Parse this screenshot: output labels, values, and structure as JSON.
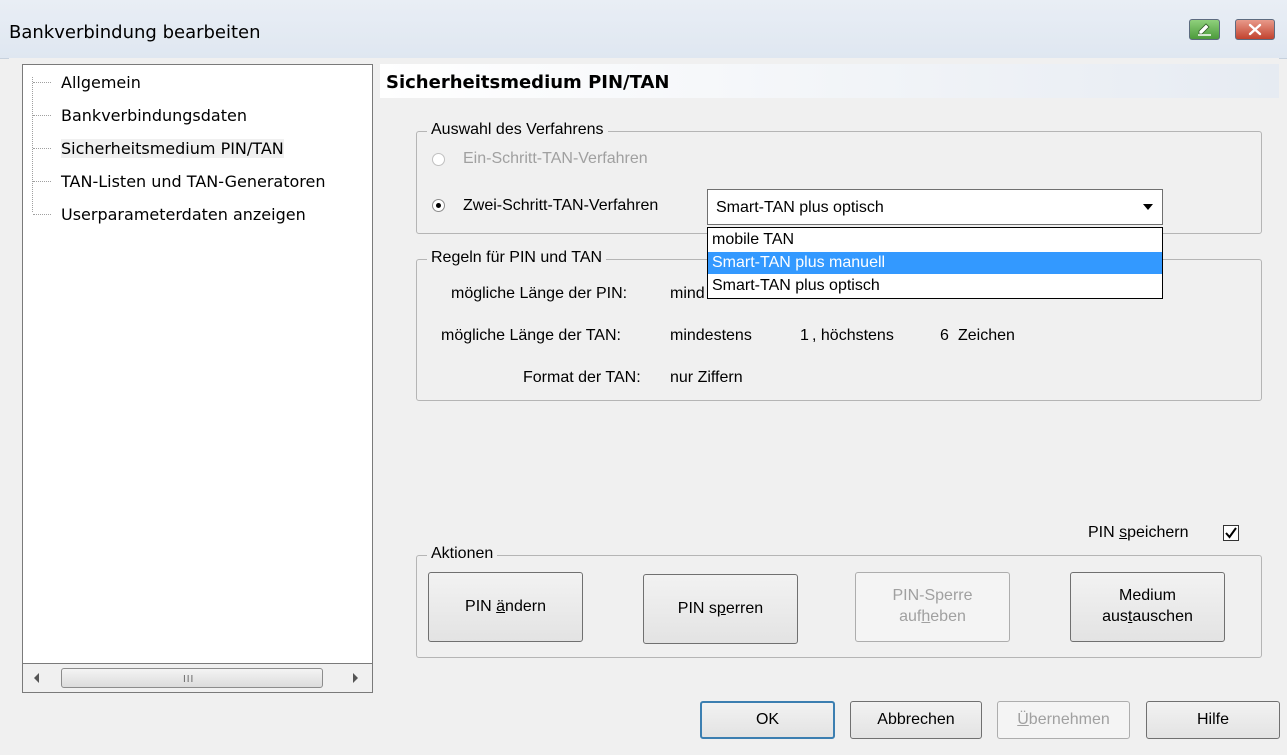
{
  "window": {
    "title": "Bankverbindung bearbeiten"
  },
  "tree": {
    "items": [
      {
        "label": "Allgemein"
      },
      {
        "label": "Bankverbindungsdaten"
      },
      {
        "label": "Sicherheitsmedium PIN/TAN"
      },
      {
        "label": "TAN-Listen und TAN-Generatoren"
      },
      {
        "label": "Userparameterdaten anzeigen"
      }
    ],
    "scroll_grip": "III"
  },
  "section": {
    "title": "Sicherheitsmedium PIN/TAN"
  },
  "verfahren": {
    "group_title": "Auswahl des Verfahrens",
    "option1": "Ein-Schritt-TAN-Verfahren",
    "option2": "Zwei-Schritt-TAN-Verfahren",
    "combo_value": "Smart-TAN plus optisch",
    "combo_options": [
      "mobile TAN",
      "Smart-TAN plus manuell",
      "Smart-TAN plus optisch"
    ],
    "highlighted_option": "Smart-TAN plus manuell"
  },
  "regeln": {
    "group_title": "Regeln für PIN und TAN",
    "pin_label": "mögliche Länge der PIN:",
    "pin_value_prefix": "mind",
    "tan_label": "mögliche Länge der TAN:",
    "tan_min_label": "mindestens",
    "tan_min": "1",
    "tan_max_label": ", höchstens",
    "tan_max": "6",
    "tan_unit": "Zeichen",
    "format_label": "Format der TAN:",
    "format_value": "nur Ziffern"
  },
  "pin_speichern": {
    "label_pre": "PIN ",
    "label_ul": "s",
    "label_post": "peichern",
    "checked": true
  },
  "aktionen": {
    "group_title": "Aktionen",
    "buttons": [
      {
        "pre": "PIN ",
        "ul": "ä",
        "post": "ndern"
      },
      {
        "pre": "PIN s",
        "ul": "p",
        "post": "erren"
      },
      {
        "line1": "PIN-Sperre",
        "line2_pre": "auf",
        "line2_ul": "h",
        "line2_post": "eben"
      },
      {
        "line1": "Medium",
        "line2_pre": "aus",
        "line2_ul": "t",
        "line2_post": "auschen"
      }
    ]
  },
  "footer": {
    "ok": "OK",
    "cancel": "Abbrechen",
    "apply_ul": "Ü",
    "apply_post": "bernehmen",
    "help": "Hilfe"
  },
  "colors": {
    "highlight": "#3399ff",
    "disabled_text": "#a0a0a0"
  }
}
